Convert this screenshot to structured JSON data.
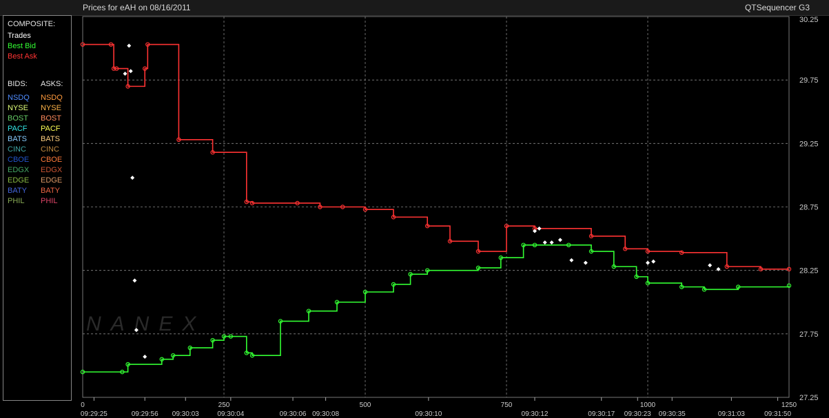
{
  "window": {
    "title": "Prices for  eAH  on  08/16/2011",
    "app_name": "QTSequencer G3"
  },
  "legend": {
    "composite_header": "COMPOSITE:",
    "composite": [
      {
        "label": "Trades",
        "color": "#ffffff"
      },
      {
        "label": "Best Bid",
        "color": "#33ff33"
      },
      {
        "label": "Best Ask",
        "color": "#ff3333"
      }
    ],
    "bids_header": "BIDS:",
    "asks_header": "ASKS:",
    "exchanges": [
      {
        "bid": "NSDQ",
        "bid_color": "#4f8cff",
        "ask": "NSDQ",
        "ask_color": "#ff9a3c"
      },
      {
        "bid": "NYSE",
        "bid_color": "#e0ff7a",
        "ask": "NYSE",
        "ask_color": "#ffb347"
      },
      {
        "bid": "BOST",
        "bid_color": "#66cc66",
        "ask": "BOST",
        "ask_color": "#ff8a5c"
      },
      {
        "bid": "PACF",
        "bid_color": "#33e6e6",
        "ask": "PACF",
        "ask_color": "#ffff55"
      },
      {
        "bid": "BATS",
        "bid_color": "#88ccff",
        "ask": "BATS",
        "ask_color": "#ffd080"
      },
      {
        "bid": "CINC",
        "bid_color": "#3fa7a7",
        "ask": "CINC",
        "ask_color": "#c08a40"
      },
      {
        "bid": "CBOE",
        "bid_color": "#2255cc",
        "ask": "CBOE",
        "ask_color": "#ff7a3a"
      },
      {
        "bid": "EDGX",
        "bid_color": "#44aa66",
        "ask": "EDGX",
        "ask_color": "#cc5533"
      },
      {
        "bid": "EDGE",
        "bid_color": "#88bb44",
        "ask": "EDGE",
        "ask_color": "#dd9966"
      },
      {
        "bid": "BATY",
        "bid_color": "#4466dd",
        "ask": "BATY",
        "ask_color": "#ee6644"
      },
      {
        "bid": "PHIL",
        "bid_color": "#88aa55",
        "ask": "PHIL",
        "ask_color": "#dd4466"
      }
    ]
  },
  "chart_data": {
    "type": "line",
    "watermark": "NANEX",
    "grid": true,
    "y_ticks": [
      "30.25",
      "29.75",
      "29.25",
      "28.75",
      "28.25",
      "27.75",
      "27.25"
    ],
    "ylim": [
      27.25,
      30.25
    ],
    "x_ticks": [
      "0",
      "250",
      "500",
      "750",
      "1000",
      "1250"
    ],
    "x_tick_values": [
      0,
      250,
      500,
      750,
      1000,
      1250
    ],
    "xlim": [
      0,
      1250
    ],
    "time_labels": [
      {
        "label": "09:29:25",
        "x": 20
      },
      {
        "label": "09:29:56",
        "x": 110
      },
      {
        "label": "09:30:03",
        "x": 182
      },
      {
        "label": "09:30:04",
        "x": 262
      },
      {
        "label": "09:30:06",
        "x": 372
      },
      {
        "label": "09:30:08",
        "x": 430
      },
      {
        "label": "09:30:10",
        "x": 612
      },
      {
        "label": "09:30:12",
        "x": 800
      },
      {
        "label": "09:30:17",
        "x": 918
      },
      {
        "label": "09:30:23",
        "x": 982
      },
      {
        "label": "09:30:35",
        "x": 1043
      },
      {
        "label": "09:31:03",
        "x": 1148
      },
      {
        "label": "09:31:50",
        "x": 1230
      }
    ],
    "series": [
      {
        "name": "Best Ask",
        "color": "#ff3333",
        "x": [
          0,
          50,
          55,
          60,
          80,
          110,
          115,
          170,
          230,
          290,
          300,
          380,
          420,
          460,
          500,
          550,
          610,
          650,
          700,
          750,
          800,
          900,
          960,
          1000,
          1060,
          1140,
          1200,
          1250
        ],
        "y": [
          30.03,
          30.03,
          29.84,
          29.84,
          29.7,
          29.84,
          30.03,
          29.28,
          29.18,
          28.79,
          28.78,
          28.78,
          28.75,
          28.75,
          28.73,
          28.67,
          28.6,
          28.48,
          28.4,
          28.6,
          28.58,
          28.52,
          28.42,
          28.4,
          28.39,
          28.28,
          28.26,
          28.26
        ]
      },
      {
        "name": "Best Bid",
        "color": "#33ff33",
        "x": [
          0,
          70,
          80,
          140,
          160,
          190,
          230,
          250,
          262,
          290,
          300,
          350,
          400,
          450,
          500,
          550,
          580,
          610,
          700,
          740,
          780,
          800,
          860,
          900,
          940,
          980,
          1000,
          1060,
          1100,
          1160,
          1250
        ],
        "y": [
          27.45,
          27.45,
          27.51,
          27.55,
          27.58,
          27.64,
          27.7,
          27.73,
          27.73,
          27.6,
          27.58,
          27.85,
          27.93,
          28.0,
          28.08,
          28.14,
          28.22,
          28.25,
          28.27,
          28.35,
          28.45,
          28.45,
          28.45,
          28.4,
          28.28,
          28.2,
          28.15,
          28.12,
          28.1,
          28.12,
          28.13
        ]
      },
      {
        "name": "Trades",
        "color": "#ffffff",
        "x": [
          75,
          82,
          85,
          88,
          92,
          95,
          110,
          800,
          808,
          818,
          830,
          845,
          865,
          890,
          1000,
          1010,
          1110,
          1125
        ],
        "y": [
          29.8,
          30.02,
          29.82,
          28.98,
          28.17,
          27.78,
          27.57,
          28.56,
          28.58,
          28.47,
          28.47,
          28.49,
          28.33,
          28.31,
          28.31,
          28.32,
          28.29,
          28.26
        ]
      }
    ]
  }
}
